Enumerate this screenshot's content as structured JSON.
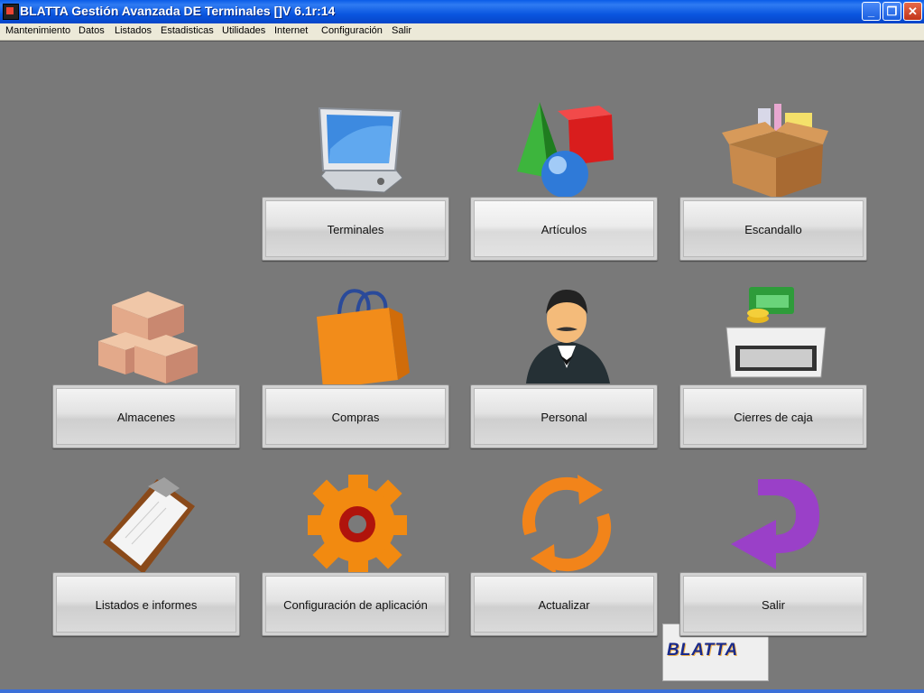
{
  "window": {
    "title": "BLATTA Gestión Avanzada DE Terminales []V 6.1r:14"
  },
  "menu": [
    "Mantenimiento",
    "Datos",
    "Listados",
    "Estadisticas",
    "Utilidades",
    "Internet",
    "Configuración",
    "Salir"
  ],
  "tiles": {
    "terminales": "Terminales",
    "articulos": "Artículos",
    "escandallo": "Escandallo",
    "almacenes": "Almacenes",
    "compras": "Compras",
    "personal": "Personal",
    "cierres": "Cierres de caja",
    "listados": "Listados e informes",
    "configuracion": "Configuración de aplicación",
    "actualizar": "Actualizar",
    "salir": "Salir"
  },
  "logo": {
    "text": "BLATTA"
  },
  "colors": {
    "title_bar": "#0a56e0",
    "desktop": "#797979",
    "menu_bar": "#ece9d8"
  }
}
